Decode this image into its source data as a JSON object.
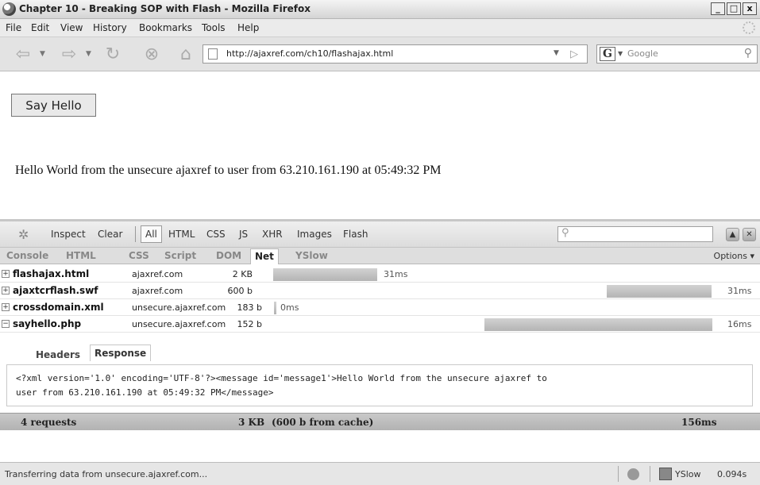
{
  "window": {
    "title": "Chapter 10 - Breaking SOP with Flash - Mozilla Firefox",
    "minimize": "_",
    "maximize": "□",
    "close": "x"
  },
  "menu": {
    "file": "File",
    "edit": "Edit",
    "view": "View",
    "history": "History",
    "bookmarks": "Bookmarks",
    "tools": "Tools",
    "help": "Help"
  },
  "nav": {
    "url": "http://ajaxref.com/ch10/flashajax.html",
    "search_engine": "G",
    "search_placeholder": "Google"
  },
  "content": {
    "button": "Say Hello",
    "message": "Hello World from the unsecure ajaxref to user from 63.210.161.190 at 05:49:32 PM"
  },
  "firebug": {
    "toolbar": {
      "inspect": "Inspect",
      "clear": "Clear",
      "filters": [
        "All",
        "HTML",
        "CSS",
        "JS",
        "XHR",
        "Images",
        "Flash"
      ]
    },
    "tabs": [
      "Console",
      "HTML",
      "CSS",
      "Script",
      "DOM",
      "Net",
      "YSlow"
    ],
    "active_tab": "Net",
    "options": "Options ▾",
    "requests": [
      {
        "file": "flashajax.html",
        "domain": "ajaxref.com",
        "size": "2 KB",
        "time": "31ms",
        "toggle": "+"
      },
      {
        "file": "ajaxtcrflash.swf",
        "domain": "ajaxref.com",
        "size": "600 b",
        "time": "31ms",
        "toggle": "+"
      },
      {
        "file": "crossdomain.xml",
        "domain": "unsecure.ajaxref.com",
        "size": "183 b",
        "time": "0ms",
        "toggle": "+"
      },
      {
        "file": "sayhello.php",
        "domain": "unsecure.ajaxref.com",
        "size": "152 b",
        "time": "16ms",
        "toggle": "−"
      }
    ],
    "detail_tabs": {
      "headers": "Headers",
      "response": "Response"
    },
    "response": [
      "<?xml version='1.0' encoding='UTF-8'?><message id='message1'>Hello World from the unsecure ajaxref to",
      "user from 63.210.161.190 at 05:49:32 PM</message>"
    ],
    "summary": {
      "requests": "4 requests",
      "size": "3 KB",
      "cache": "(600 b from cache)",
      "total": "156ms"
    }
  },
  "status": {
    "text": "Transferring data from unsecure.ajaxref.com...",
    "yslow": "YSlow",
    "yslow_time": "0.094s"
  }
}
